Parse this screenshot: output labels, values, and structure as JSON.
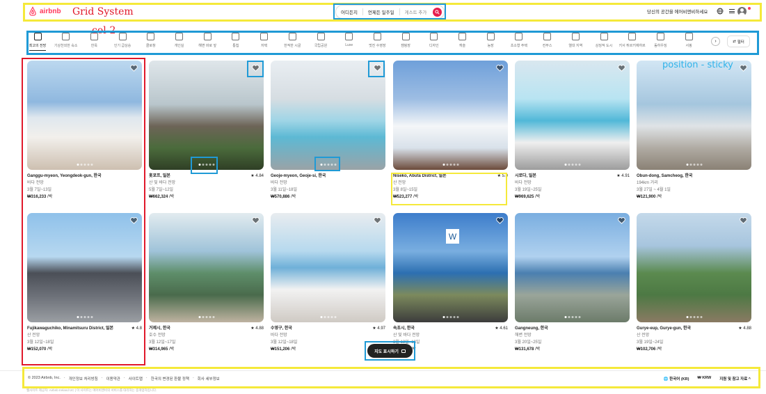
{
  "header": {
    "logo_text": "airbnb",
    "search": {
      "where": "어디든지",
      "when": "언제든 일주일",
      "guests": "게스트 추가"
    },
    "host_link": "당신의 공간을 에어비앤비하세요"
  },
  "categories": [
    {
      "label": "최고의 전망",
      "active": true
    },
    {
      "label": "기상천외한 숙소"
    },
    {
      "label": "한옥"
    },
    {
      "label": "인기 급상승"
    },
    {
      "label": "클로창"
    },
    {
      "label": "개인실"
    },
    {
      "label": "해변 바로 앞"
    },
    {
      "label": "통칩"
    },
    {
      "label": "저택"
    },
    {
      "label": "한적한 시골"
    },
    {
      "label": "국립공원"
    },
    {
      "label": "Luxe"
    },
    {
      "label": "멋진 수영장"
    },
    {
      "label": "캠핑장"
    },
    {
      "label": "디자인"
    },
    {
      "label": "캐슬"
    },
    {
      "label": "농장"
    },
    {
      "label": "초소형 주택"
    },
    {
      "label": "컨부스"
    },
    {
      "label": "열대 지역"
    },
    {
      "label": "상징적 도시"
    },
    {
      "label": "키서 튀르키예하르"
    },
    {
      "label": "돔하우징"
    },
    {
      "label": "서핑"
    }
  ],
  "filter_label": "필터",
  "listings": [
    {
      "location": "Ganggu-myeon, Yeongdeok-gun, 한국",
      "rating": "",
      "subtitle": "바다 전망",
      "dates": "3월 7일~13일",
      "price": "₩316,233",
      "unit": " /박"
    },
    {
      "location": "홋쿄프, 일본",
      "rating": "★ 4.84",
      "subtitle": "산 및 바다 전망",
      "dates": "5월 7일~12일",
      "price": "₩662,324",
      "unit": " /박"
    },
    {
      "location": "Geoje-myeon, Geoje-si, 한국",
      "rating": "",
      "subtitle": "바다 전망",
      "dates": "3월 11일~18일",
      "price": "₩570,886",
      "unit": " /박"
    },
    {
      "location": "Niseko, Abuta District, 일본",
      "rating": "★ 5.0",
      "subtitle": "산 전망",
      "dates": "3월 8일~15일",
      "price": "₩523,277",
      "unit": " /박"
    },
    {
      "location": "시로다, 일본",
      "rating": "★ 4.91",
      "subtitle": "바다 전망",
      "dates": "3월 19일~25일",
      "price": "₩969,625",
      "unit": " /박"
    },
    {
      "location": "Obun-dong, Samcheog, 한국",
      "rating": "",
      "subtitle": "194km 거리",
      "dates": "3월 27일 ~ 4월 1일",
      "price": "₩121,900",
      "unit": " /박"
    },
    {
      "location": "Fujikawaguchiko, Minamitsuru District, 일본",
      "rating": "★ 4.8",
      "subtitle": "산 전망",
      "dates": "3월 12일~18일",
      "price": "₩152,070",
      "unit": " /박"
    },
    {
      "location": "거제시, 한국",
      "rating": "★ 4.88",
      "subtitle": "호수 전망",
      "dates": "3월 12일~17일",
      "price": "₩314,965",
      "unit": " /박"
    },
    {
      "location": "수영구, 한국",
      "rating": "★ 4.97",
      "subtitle": "바다 전망",
      "dates": "3월 12일~18일",
      "price": "₩151,206",
      "unit": " /박"
    },
    {
      "location": "속초시, 한국",
      "rating": "★ 4.61",
      "subtitle": "산 및 바다 전망",
      "dates": "3월 13일~18일",
      "price": "₩92,158",
      "unit": " /박"
    },
    {
      "location": "Gangneung, 한국",
      "rating": "",
      "subtitle": "해변 전망",
      "dates": "3월 20일~25일",
      "price": "₩131,678",
      "unit": " /박"
    },
    {
      "location": "Gurye-eup, Gurye-gun, 한국",
      "rating": "★ 4.88",
      "subtitle": "산 전망",
      "dates": "3월 19일~24일",
      "price": "₩102,706",
      "unit": " /박"
    }
  ],
  "map_toggle": "지도 표시하기",
  "footer": {
    "links": [
      "© 2023 Airbnb, Inc.",
      "·",
      "개인정보 처리방침",
      "·",
      "이용약관",
      "·",
      "사이트맵",
      "·",
      "한국의 변경된 환불 정책",
      "·",
      "회사 세부정보"
    ],
    "language": "한국어 (KR)",
    "currency": "₩  KRW",
    "support": "지원 및 참고 자료  ^",
    "fine_print": "웹사이트 제공자: Airbnb Ireland UC | 이 사이트는 에어비앤비의 서비스를 대리하는 중개업자입니다."
  },
  "annotations": {
    "grid_system": "Grid System",
    "col": "col-2",
    "position_sticky": "position - sticky",
    "w_box": "W"
  },
  "colors": {
    "brand": "#ff385c",
    "search_button": "#e61e4d",
    "annotation_yellow": "#f5e93a",
    "annotation_blue": "#1f9ad6",
    "annotation_red": "#e0182a"
  }
}
